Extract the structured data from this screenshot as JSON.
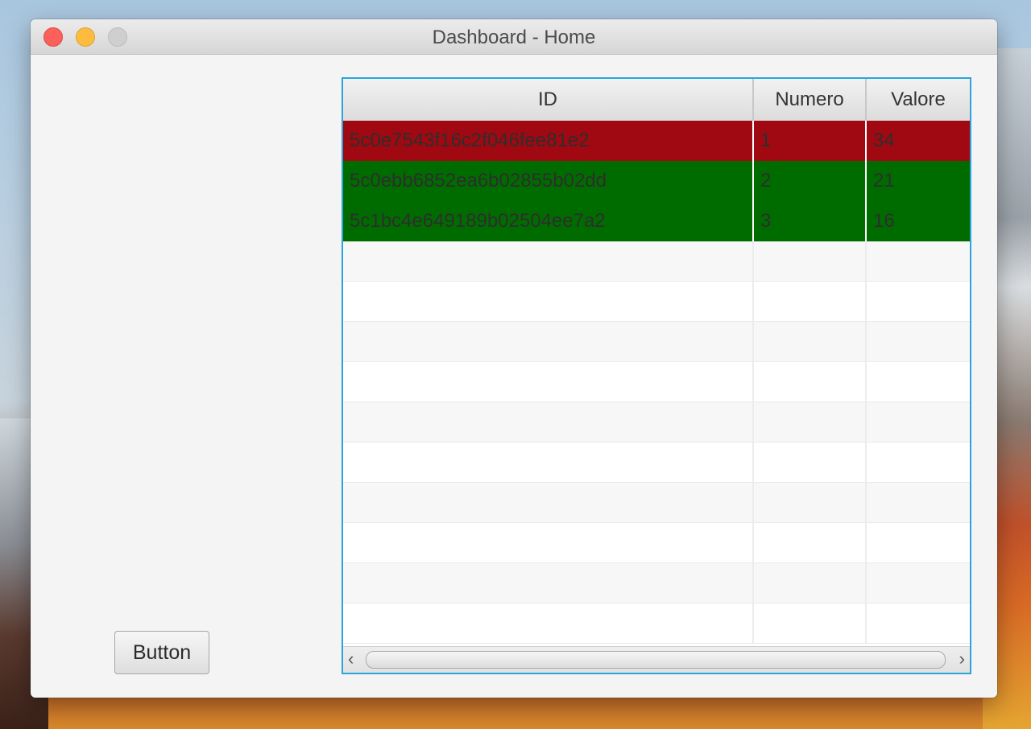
{
  "window": {
    "title": "Dashboard - Home"
  },
  "table": {
    "headers": [
      "ID",
      "Numero",
      "Valore"
    ],
    "rows": [
      {
        "id": "5c0e7543f16c2f046fee81e2",
        "numero": "1",
        "valore": "34",
        "status_color": "#a00911"
      },
      {
        "id": "5c0ebb6852ea6b02855b02dd",
        "numero": "2",
        "valore": "21",
        "status_color": "#006c00"
      },
      {
        "id": "5c1bc4e649189b02504ee7a2",
        "numero": "3",
        "valore": "16",
        "status_color": "#006c00"
      }
    ]
  },
  "button": {
    "label": "Button"
  },
  "icons": {
    "scroll_left": "‹",
    "scroll_right": "›"
  },
  "colors": {
    "focus_border": "#2aa4dc",
    "row_red": "#a00911",
    "row_green": "#006c00"
  }
}
